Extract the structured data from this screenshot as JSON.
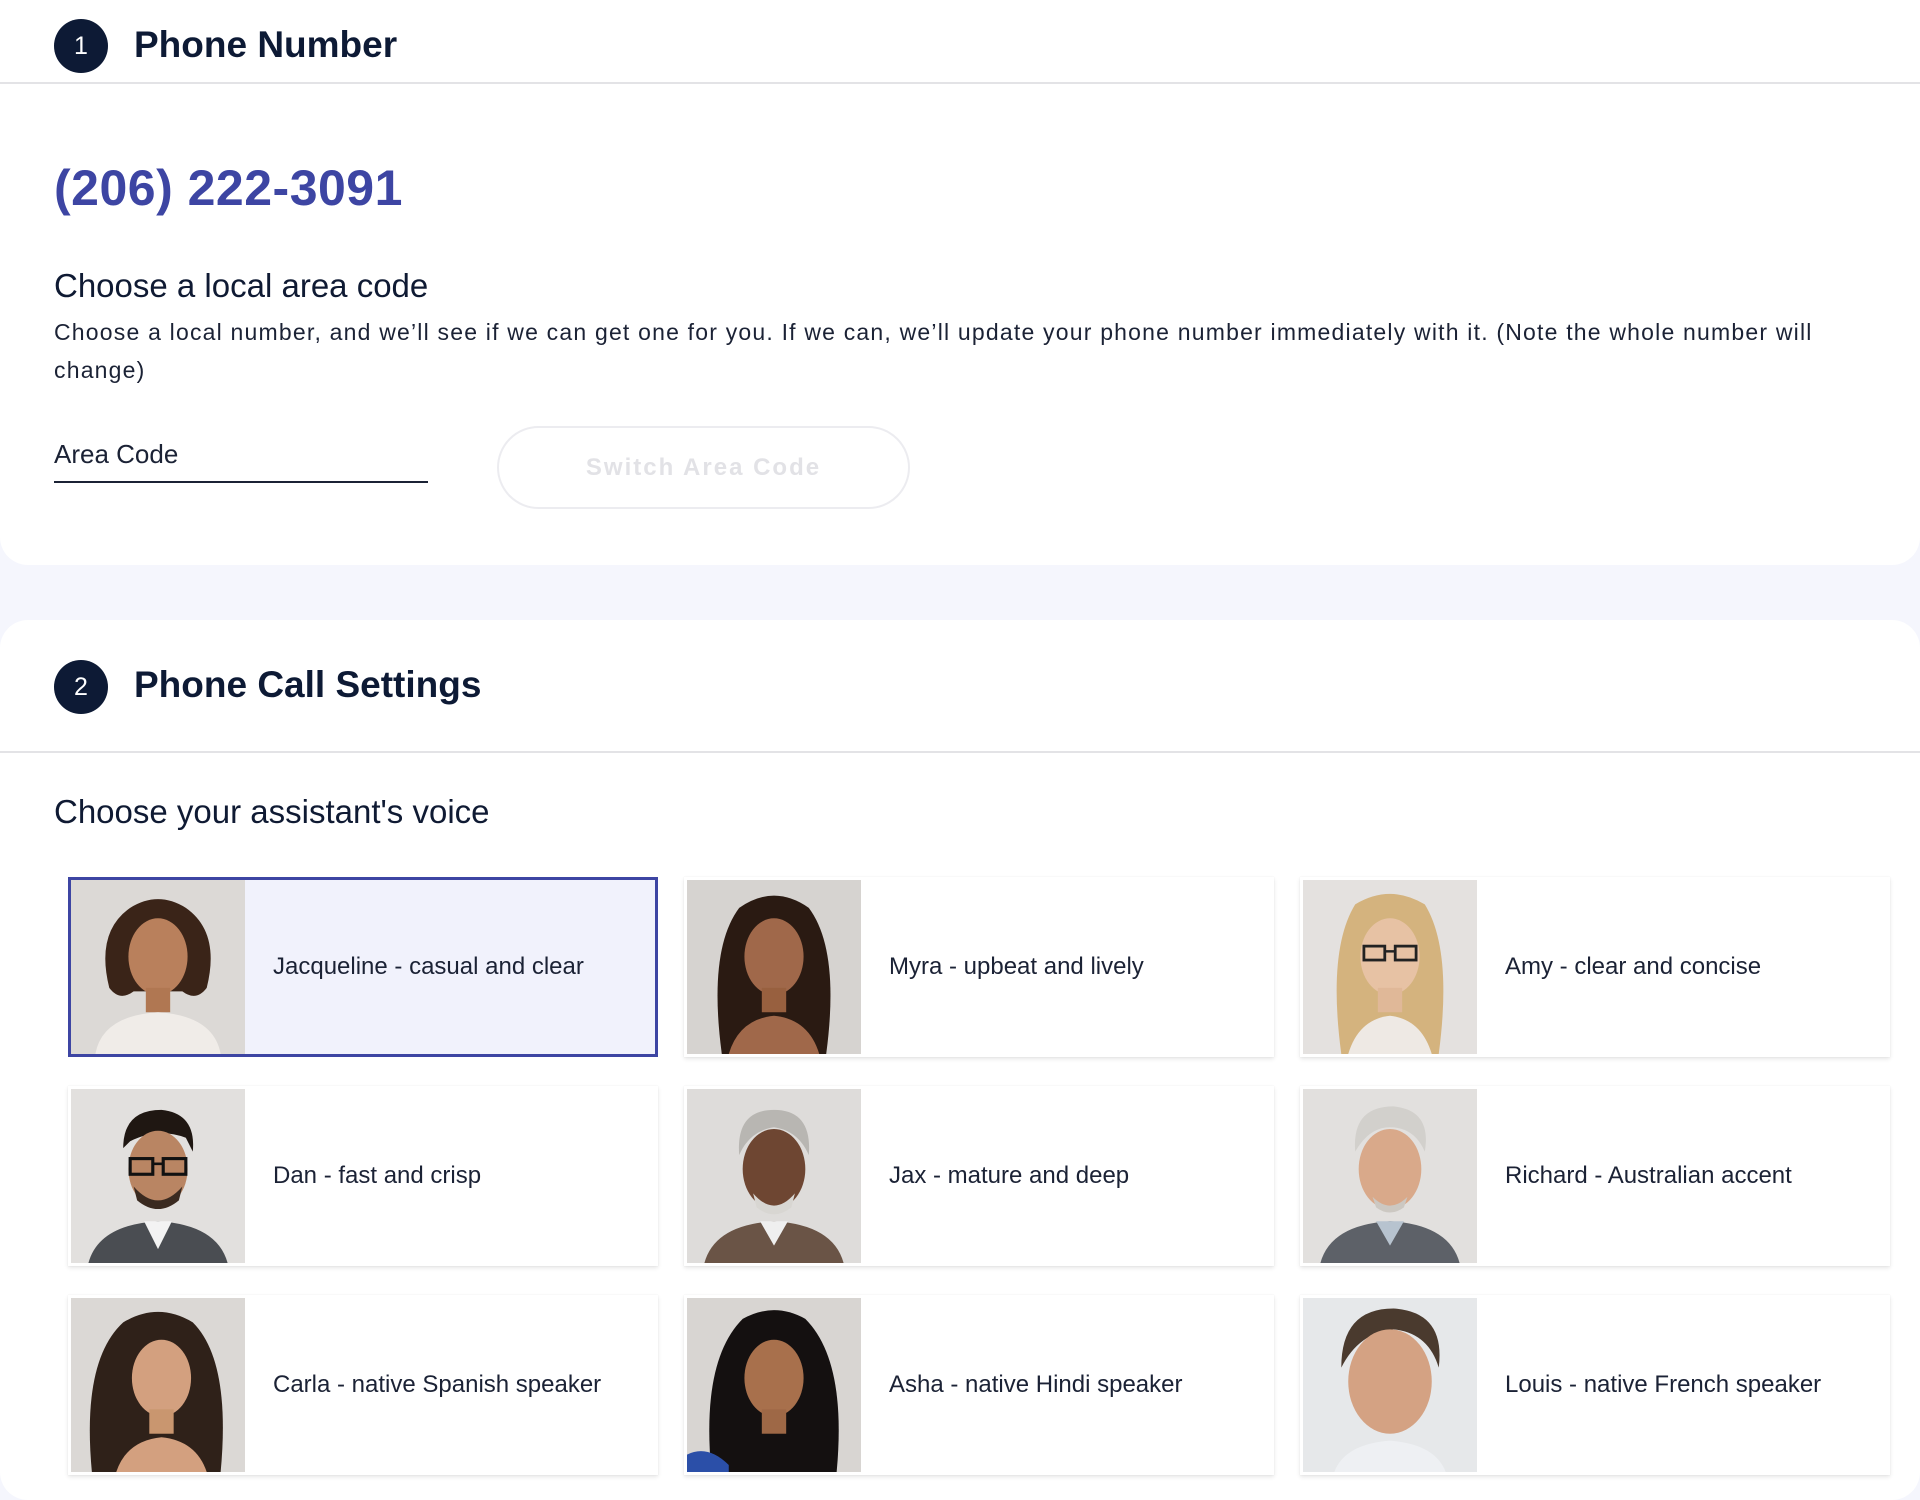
{
  "section1": {
    "step": "1",
    "title": "Phone Number",
    "phone_number": "(206) 222-3091",
    "area_heading": "Choose a local area code",
    "area_description": "Choose a local number, and we’ll see if we can get one for you. If we can, we’ll update your phone number immediately with it. (Note the whole number will change)",
    "area_code_placeholder": "Area Code",
    "switch_button": "Switch Area Code"
  },
  "section2": {
    "step": "2",
    "title": "Phone Call Settings",
    "voice_heading": "Choose your assistant's voice",
    "voices": [
      {
        "label": "Jacqueline - casual and clear",
        "selected": true
      },
      {
        "label": "Myra - upbeat and lively",
        "selected": false
      },
      {
        "label": "Amy - clear and concise",
        "selected": false
      },
      {
        "label": "Dan - fast and crisp",
        "selected": false
      },
      {
        "label": "Jax - mature and deep",
        "selected": false
      },
      {
        "label": "Richard - Australian accent",
        "selected": false
      },
      {
        "label": "Carla - native Spanish speaker",
        "selected": false
      },
      {
        "label": "Asha - native Hindi speaker",
        "selected": false
      },
      {
        "label": "Louis - native French speaker",
        "selected": false
      }
    ]
  },
  "colors": {
    "accent": "#3d45a3",
    "badge": "#0d1a35",
    "page_background": "#f5f6fd",
    "selected_background": "#f1f2fc"
  }
}
